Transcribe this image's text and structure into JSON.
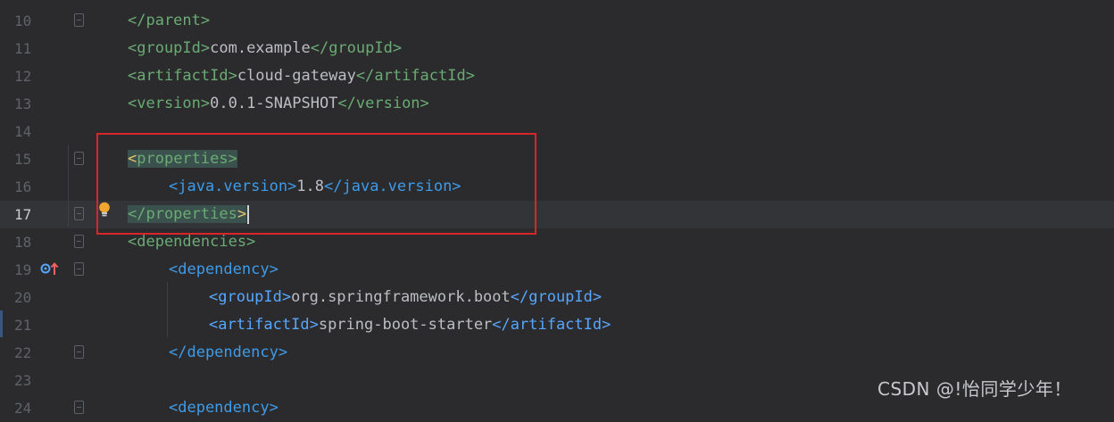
{
  "editor": {
    "lines": [
      {
        "num": "10",
        "segments": [
          [
            "tag",
            "</parent>"
          ]
        ]
      },
      {
        "num": "11",
        "segments": [
          [
            "tag",
            "<groupId>"
          ],
          [
            "txt",
            "com.example"
          ],
          [
            "tag",
            "</groupId>"
          ]
        ]
      },
      {
        "num": "12",
        "segments": [
          [
            "tag",
            "<artifactId>"
          ],
          [
            "txt",
            "cloud-gateway"
          ],
          [
            "tag",
            "</artifactId>"
          ]
        ]
      },
      {
        "num": "13",
        "segments": [
          [
            "tag",
            "<version>"
          ],
          [
            "txt",
            "0.0.1-SNAPSHOT"
          ],
          [
            "tag",
            "</version>"
          ]
        ]
      },
      {
        "num": "14",
        "segments": []
      },
      {
        "num": "15",
        "segments": [
          [
            "tag",
            "<properties>"
          ]
        ]
      },
      {
        "num": "16",
        "segments": [
          [
            "tagb",
            "<java.version>"
          ],
          [
            "txt",
            "1.8"
          ],
          [
            "tagb",
            "</java.version>"
          ]
        ]
      },
      {
        "num": "17",
        "segments": [
          [
            "tag",
            "</properties>"
          ]
        ]
      },
      {
        "num": "18",
        "segments": [
          [
            "tag",
            "<dependencies>"
          ]
        ]
      },
      {
        "num": "19",
        "segments": [
          [
            "tagb",
            "<dependency>"
          ]
        ]
      },
      {
        "num": "20",
        "segments": [
          [
            "tag2",
            "<groupId>"
          ],
          [
            "txt",
            "org.springframework.boot"
          ],
          [
            "tag2",
            "</groupId>"
          ]
        ]
      },
      {
        "num": "21",
        "segments": [
          [
            "tag2",
            "<artifactId>"
          ],
          [
            "txt",
            "spring-boot-starter"
          ],
          [
            "tag2",
            "</artifactId>"
          ]
        ]
      },
      {
        "num": "22",
        "segments": [
          [
            "tagb",
            "</dependency>"
          ]
        ]
      },
      {
        "num": "23",
        "segments": []
      },
      {
        "num": "24",
        "segments": [
          [
            "tagb",
            "<dependency>"
          ]
        ]
      }
    ]
  },
  "watermark": "CSDN @!怡同学少年！",
  "colors": {
    "background": "#2b2b2d",
    "current_line": "#323438",
    "selection_box": "#d8252c",
    "tag_green": "#6aab73",
    "tag_blue": "#3d9be9"
  }
}
